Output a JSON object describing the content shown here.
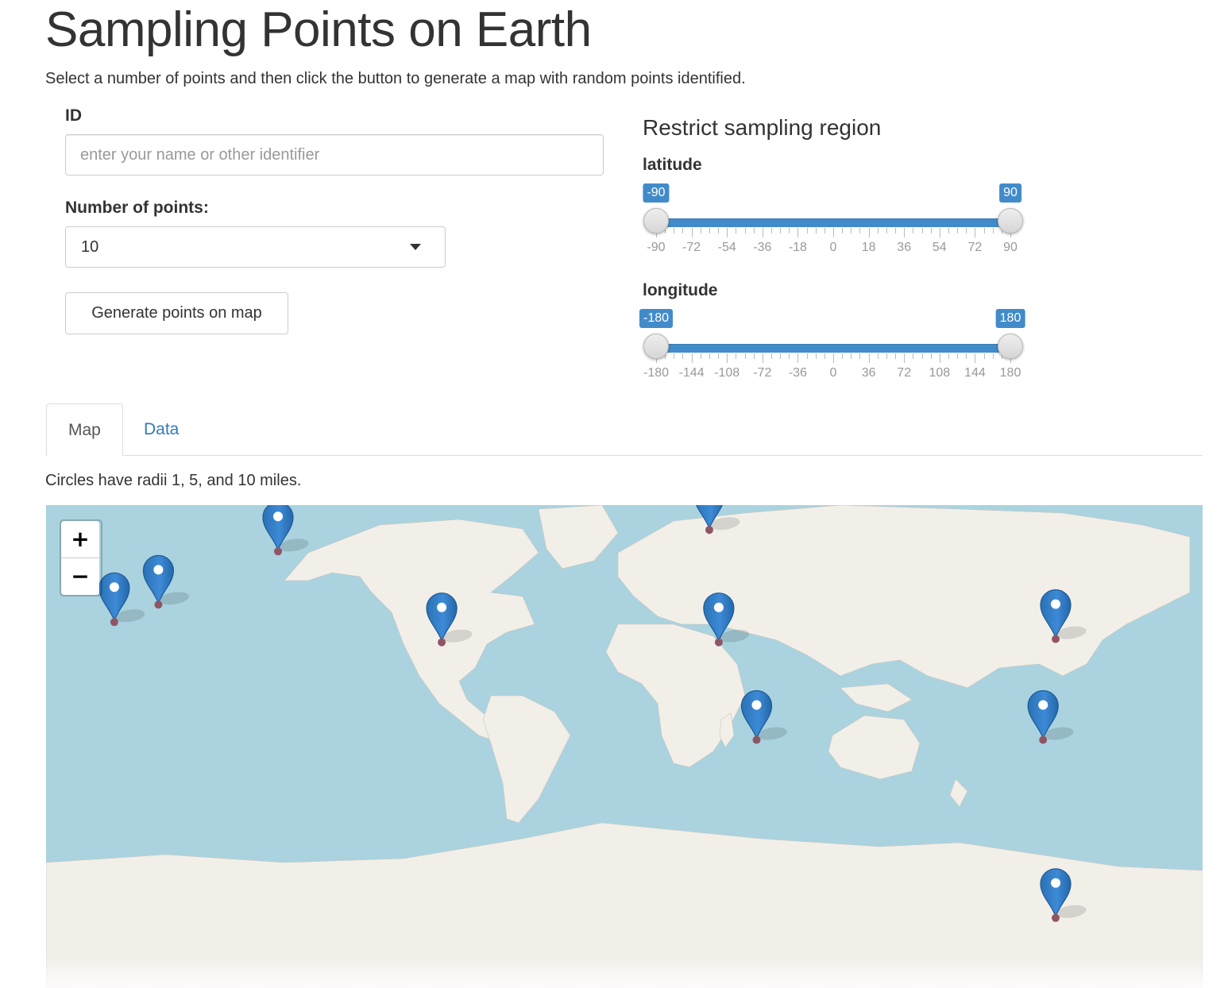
{
  "page": {
    "title": "Sampling Points on Earth",
    "intro": "Select a number of points and then click the button to generate a map with random points identified."
  },
  "form": {
    "id_label": "ID",
    "id_placeholder": "enter your name or other identifier",
    "id_value": "",
    "points_label": "Number of points:",
    "points_value": "10",
    "generate_label": "Generate points on map"
  },
  "region": {
    "title": "Restrict sampling region",
    "latitude": {
      "label": "latitude",
      "min": -90,
      "max": 90,
      "from": -90,
      "to": 90,
      "from_label": "-90",
      "to_label": "90",
      "tick_labels": [
        "-90",
        "-72",
        "-54",
        "-36",
        "-18",
        "0",
        "18",
        "36",
        "54",
        "72",
        "90"
      ]
    },
    "longitude": {
      "label": "longitude",
      "min": -180,
      "max": 180,
      "from": -180,
      "to": 180,
      "from_label": "-180",
      "to_label": "180",
      "tick_labels": [
        "-180",
        "-144",
        "-108",
        "-72",
        "-36",
        "0",
        "36",
        "72",
        "108",
        "144",
        "180"
      ]
    }
  },
  "tabs": {
    "map": "Map",
    "data": "Data",
    "active": "Map"
  },
  "map_caption": "Circles have radii 1, 5, and 10 miles.",
  "map": {
    "zoom_in": "+",
    "zoom_out": "−",
    "marker_icon": "map-marker-icon",
    "markers": [
      {
        "lon": -162,
        "lat": 20
      },
      {
        "lon": -148,
        "lat": 25
      },
      {
        "lon": -110,
        "lat": 39
      },
      {
        "lon": -58,
        "lat": 14
      },
      {
        "lon": 27,
        "lat": 44
      },
      {
        "lon": 30,
        "lat": 14
      },
      {
        "lon": 42,
        "lat": -16
      },
      {
        "lon": 133,
        "lat": -16
      },
      {
        "lon": 137,
        "lat": 15
      },
      {
        "lon": 137,
        "lat": -58
      }
    ]
  },
  "colors": {
    "accent": "#428bca",
    "link": "#337ab7",
    "water": "#aad3df",
    "land": "#f2efe9",
    "marker": "#2a81cb",
    "marker_dot": "#8e5566"
  }
}
